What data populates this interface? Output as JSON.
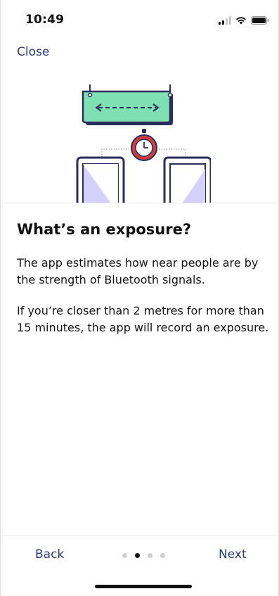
{
  "status_bar": {
    "time": "10:49",
    "icons": [
      "cellular-signal-icon",
      "wifi-icon",
      "battery-icon"
    ]
  },
  "header": {
    "close_label": "Close"
  },
  "illustration": {
    "name": "bluetooth-distance-illustration",
    "colors": {
      "sign": "#7fe0b4",
      "outline": "#2b2d5c",
      "timer": "#d23c3c",
      "phone_screen": "#d6d0ff"
    }
  },
  "content": {
    "heading": "What’s an exposure?",
    "paragraph_1": "The app estimates how near people are by the strength of Bluetooth signals.",
    "paragraph_2": "If you’re closer than 2 metres for more than 15 minutes, the app will record an exposure."
  },
  "footer": {
    "back_label": "Back",
    "next_label": "Next",
    "page_indicator": {
      "total": 4,
      "current": 2
    }
  },
  "colors": {
    "accent": "#2c3a7a",
    "text": "#111111",
    "dot_inactive": "#cfcfcf",
    "dot_active": "#111111"
  }
}
